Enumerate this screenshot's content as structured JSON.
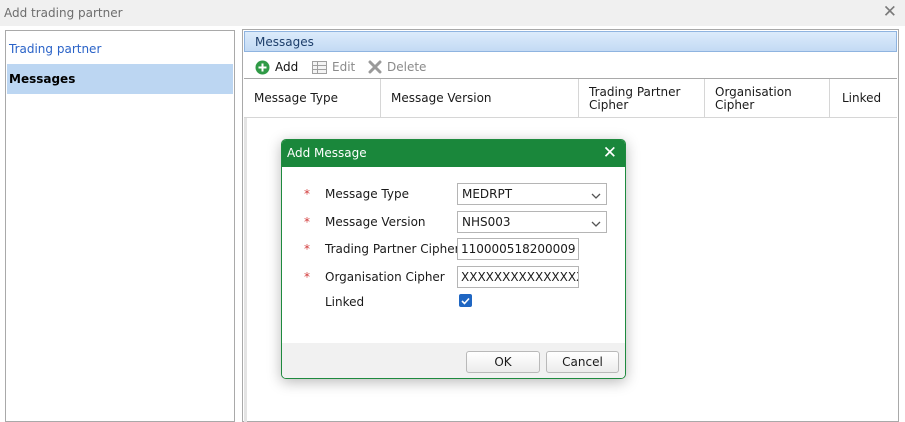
{
  "window": {
    "title": "Add trading partner"
  },
  "sidebar": {
    "items": [
      {
        "label": "Trading partner",
        "active": false
      },
      {
        "label": "Messages",
        "active": true
      }
    ]
  },
  "main": {
    "section_title": "Messages",
    "toolbar": {
      "add_label": "Add",
      "edit_label": "Edit",
      "delete_label": "Delete"
    },
    "columns": [
      "Message Type",
      "Message Version",
      "Trading Partner Cipher",
      "Organisation Cipher",
      "Linked"
    ]
  },
  "dialog": {
    "title": "Add Message",
    "required_marker": "*",
    "fields": {
      "message_type": {
        "label": "Message Type",
        "value": "MEDRPT"
      },
      "message_version": {
        "label": "Message Version",
        "value": "NHS003"
      },
      "trading_partner_cipher": {
        "label": "Trading Partner Cipher",
        "value": "110000518200009"
      },
      "organisation_cipher": {
        "label": "Organisation Cipher",
        "value": "XXXXXXXXXXXXXXX"
      },
      "linked": {
        "label": "Linked",
        "checked": true
      }
    },
    "ok_label": "OK",
    "cancel_label": "Cancel"
  },
  "colors": {
    "dialog_title_bg": "#1a873b",
    "selected_item_bg": "#bcd6f2",
    "link_color": "#2a63c8",
    "required_color": "#d23b3b",
    "checkbox_color": "#1f66c2"
  },
  "icons": {
    "add": "add-circle-icon",
    "edit": "grid-edit-icon",
    "delete": "delete-x-icon",
    "window_close": "close-icon",
    "dropdown": "chevron-down-icon",
    "check": "check-icon"
  }
}
